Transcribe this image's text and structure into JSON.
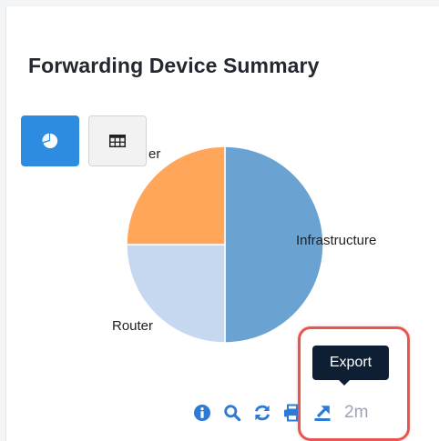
{
  "card": {
    "title": "Forwarding Device Summary"
  },
  "view_toggle": {
    "active": "pie-chart"
  },
  "chart_data": {
    "type": "pie",
    "slices": [
      {
        "label": "Infrastructure",
        "value": 50,
        "color": "#6aa3d2"
      },
      {
        "label": "Router",
        "value": 25,
        "color": "#c6d8ef"
      },
      {
        "label": "er",
        "value": 25,
        "color": "#ffa65a"
      }
    ]
  },
  "toolbar": {
    "icons": [
      "info-icon",
      "search-icon",
      "refresh-icon",
      "print-icon",
      "export-icon"
    ],
    "accent_color": "#2d7ad6",
    "time_label": "2m"
  },
  "tooltip": {
    "text": "Export"
  },
  "highlight_color": "#e8574f"
}
